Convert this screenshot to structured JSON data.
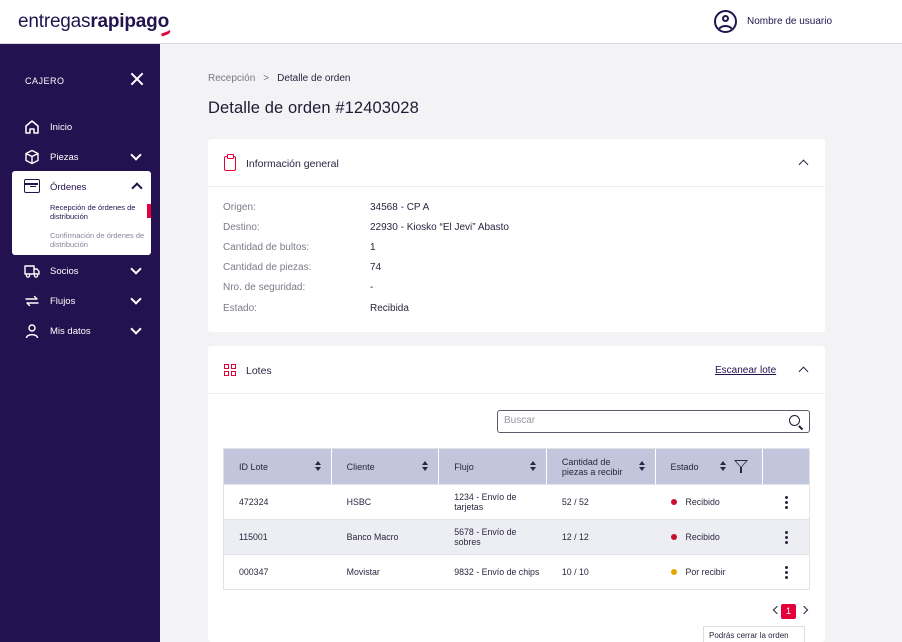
{
  "brand": {
    "part1": "entregas",
    "part2": "rapipago",
    "accent": "#e4003a",
    "primary": "#23124f"
  },
  "header": {
    "user_name": "Nombre de usuario",
    "user_icon": "user-circle-icon"
  },
  "sidebar": {
    "title": "CAJERO",
    "close_icon": "close-icon",
    "items": [
      {
        "label": "Inicio",
        "icon": "home-icon"
      },
      {
        "label": "Piezas",
        "icon": "box-icon"
      },
      {
        "label": "Órdenes",
        "icon": "orders-icon"
      },
      {
        "label": "Socios",
        "icon": "truck-icon"
      },
      {
        "label": "Flujos",
        "icon": "arrows-icon"
      },
      {
        "label": "Mis datos",
        "icon": "user-icon"
      }
    ],
    "orders_sub": [
      "Recepción de órdenes de distribución",
      "Confirmación de órdenes de distribución"
    ]
  },
  "breadcrumb": {
    "parent": "Recepción",
    "separator": ">",
    "current": "Detalle de orden"
  },
  "page": {
    "title": "Detalle de orden #12403028"
  },
  "info": {
    "title": "Información general",
    "rows": [
      {
        "key": "Origen:",
        "value": "34568 - CP A"
      },
      {
        "key": "Destino:",
        "value": "22930 - Kiosko “El Jevi” Abasto"
      },
      {
        "key": "Cantidad de bultos:",
        "value": "1"
      },
      {
        "key": "Cantidad de piezas:",
        "value": "74"
      },
      {
        "key": "Nro. de seguridad:",
        "value": "-"
      },
      {
        "key": "Estado:",
        "value": "Recibida"
      }
    ]
  },
  "lotes": {
    "title": "Lotes",
    "scan_link": "Escanear lote",
    "search_placeholder": "Buscar",
    "columns": [
      "ID Lote",
      "Cliente",
      "Flujo",
      "Cantidad de piezas a recibir",
      "Estado"
    ],
    "rows": [
      {
        "id": "472324",
        "cliente": "HSBC",
        "flujo": "1234 - Envío de tarjetas",
        "cantidad": "52 / 52",
        "estado": "Recibido",
        "color": "#c8102e"
      },
      {
        "id": "115001",
        "cliente": "Banco Macro",
        "flujo": "5678 - Envío de sobres",
        "cantidad": "12 / 12",
        "estado": "Recibido",
        "color": "#c8102e"
      },
      {
        "id": "000347",
        "cliente": "Movistar",
        "flujo": "9832 - Envío de chips",
        "cantidad": "10 / 10",
        "estado": "Por recibir",
        "color": "#e6a500"
      }
    ],
    "page": "1"
  },
  "tooltip": "Podrás cerrar la orden"
}
